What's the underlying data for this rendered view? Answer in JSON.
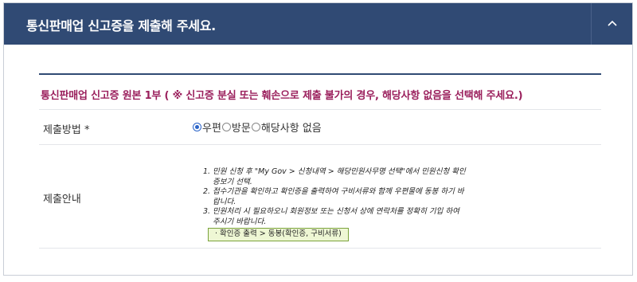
{
  "header": {
    "title": "통신판매업 신고증을 제출해 주세요.",
    "toggle_icon": "chevron-up-icon"
  },
  "notice": "통신판매업 신고증 원본 1부 ( ※ 신고증 분실 또는 훼손으로 제출 불가의 경우, 해당사항 없음을 선택해 주세요.)",
  "method": {
    "label": "제출방법 *",
    "options": [
      {
        "label": "우편",
        "checked": true
      },
      {
        "label": "방문",
        "checked": false
      },
      {
        "label": "해당사항 없음",
        "checked": false
      }
    ]
  },
  "guide": {
    "label": "제출안내",
    "items": [
      {
        "num": "1.",
        "text": "민원 신청 후 \"My Gov > 신청내역 > 해당민원사무명 선택\"에서 민원신청 확인증보기 선택."
      },
      {
        "num": "2.",
        "text": "접수기관을 확인하고 확인증을 출력하여 구비서류와 함께 우편물에 동봉 하기 바랍니다."
      },
      {
        "num": "3.",
        "text": "민원처리 시 필요하오니 회원정보 또는 신청서 상에 연락처를 정확히 기입 하여 주시기 바랍니다."
      }
    ],
    "badge": "· 확인증 출력  >  동봉(확인증, 구비서류)"
  },
  "colors": {
    "header_bg": "#304a74",
    "notice_text": "#9a1f5c",
    "radio_checked": "#2b64c8",
    "badge_bg": "#eef7d4",
    "badge_border": "#7ba33c"
  }
}
